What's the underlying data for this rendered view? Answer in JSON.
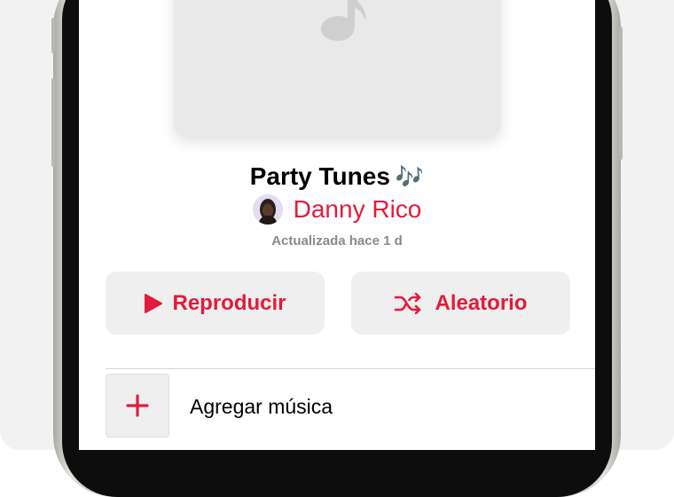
{
  "playlist": {
    "title": "Party Tunes",
    "title_emoji": "🎶",
    "curator": "Danny Rico",
    "updated": "Actualizada hace 1 d"
  },
  "actions": {
    "play_label": "Reproducir",
    "shuffle_label": "Aleatorio"
  },
  "add_music": {
    "label": "Agregar música"
  },
  "icons": {
    "artwork": "music-note-icon",
    "play": "play-icon",
    "shuffle": "shuffle-icon",
    "add": "plus-icon"
  },
  "colors": {
    "accent": "#e31b3c",
    "button_bg": "#efefef",
    "artwork_bg": "#e9e9e9",
    "secondary_text": "#8a8a8e"
  }
}
